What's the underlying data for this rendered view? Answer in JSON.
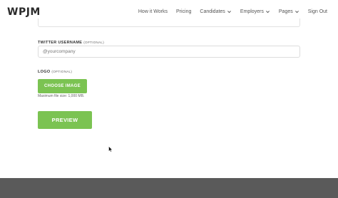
{
  "header": {
    "logo": "WPJM",
    "nav": [
      {
        "label": "How it Works",
        "has_dropdown": false
      },
      {
        "label": "Pricing",
        "has_dropdown": false
      },
      {
        "label": "Candidates",
        "has_dropdown": true
      },
      {
        "label": "Employers",
        "has_dropdown": true
      },
      {
        "label": "Pages",
        "has_dropdown": true
      },
      {
        "label": "Sign Out",
        "has_dropdown": false
      }
    ]
  },
  "form": {
    "twitter": {
      "label": "Twitter username",
      "optional": "(optional)",
      "placeholder": "@yourcompany",
      "value": ""
    },
    "logo": {
      "label": "Logo",
      "optional": "(optional)",
      "button_label": "Choose Image",
      "hint": "Maximum file size: 1,000 MB."
    },
    "preview_label": "Preview"
  },
  "colors": {
    "accent": "#7bc352",
    "footer": "#5a5a5a",
    "text": "#333333"
  }
}
